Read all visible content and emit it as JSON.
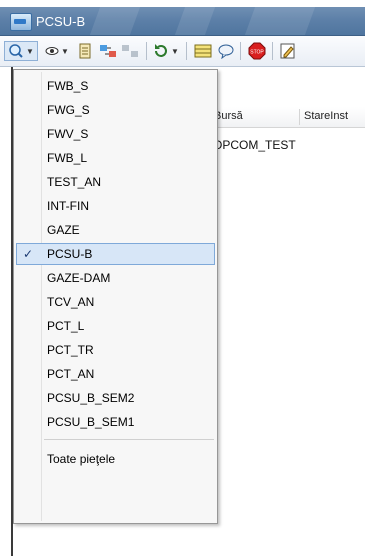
{
  "window": {
    "title": "PCSU-B"
  },
  "grid": {
    "columns": [
      "Bursă",
      "StareInst"
    ],
    "rows": [
      [
        "OPCOM_TEST"
      ]
    ]
  },
  "toolbar": {
    "icons": [
      "market-selector-icon",
      "eye-icon",
      "document-icon",
      "transfer-icon",
      "transfer-disabled-icon",
      "refresh-icon",
      "grid-icon",
      "message-icon",
      "stop-icon",
      "edit-icon"
    ],
    "stop_label": "STOP"
  },
  "dropdown": {
    "items": [
      {
        "label": "FWB_S",
        "checked": false
      },
      {
        "label": "FWG_S",
        "checked": false
      },
      {
        "label": "FWV_S",
        "checked": false
      },
      {
        "label": "FWB_L",
        "checked": false
      },
      {
        "label": "TEST_AN",
        "checked": false
      },
      {
        "label": "INT-FIN",
        "checked": false
      },
      {
        "label": "GAZE",
        "checked": false
      },
      {
        "label": "PCSU-B",
        "checked": true
      },
      {
        "label": "GAZE-DAM",
        "checked": false
      },
      {
        "label": "TCV_AN",
        "checked": false
      },
      {
        "label": "PCT_L",
        "checked": false
      },
      {
        "label": "PCT_TR",
        "checked": false
      },
      {
        "label": "PCT_AN",
        "checked": false
      },
      {
        "label": "PCSU_B_SEM2",
        "checked": false
      },
      {
        "label": "PCSU_B_SEM1",
        "checked": false
      }
    ],
    "footer_item": "Toate pieţele",
    "checkmark": "✓"
  }
}
